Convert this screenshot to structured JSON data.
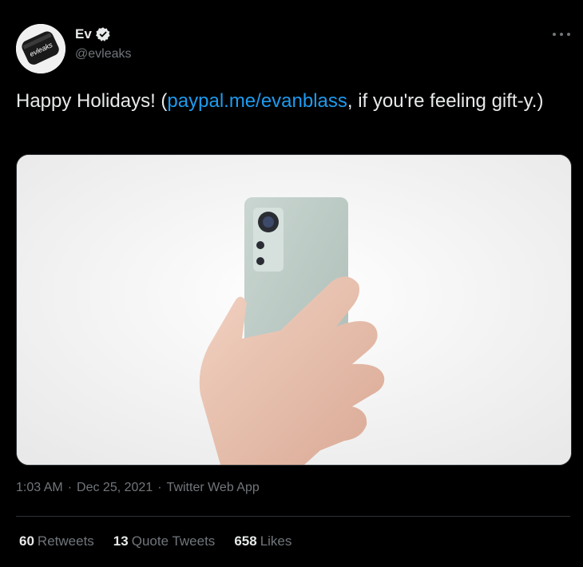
{
  "author": {
    "display_name": "Ev",
    "handle": "@evleaks",
    "avatar_text": "evleaks"
  },
  "tweet": {
    "text_before": "Happy Holidays! (",
    "link": "paypal.me/evanblass",
    "text_after": ", if you're feeling gift-y.)"
  },
  "meta": {
    "time": "1:03 AM",
    "sep1": "·",
    "date": "Dec 25, 2021",
    "sep2": "·",
    "source": "Twitter Web App"
  },
  "stats": {
    "retweets_count": "60",
    "retweets_label": "Retweets",
    "quotes_count": "13",
    "quotes_label": "Quote Tweets",
    "likes_count": "658",
    "likes_label": "Likes"
  },
  "colors": {
    "background": "#000000",
    "link": "#1d9bf0",
    "secondary_text": "#71767b",
    "divider": "#2f3336"
  }
}
